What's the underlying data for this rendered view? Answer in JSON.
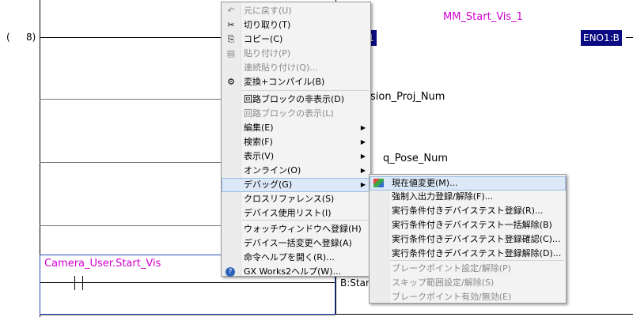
{
  "ladder": {
    "row_label_paren": "(",
    "row_label_num": "8)",
    "fb_title": "MM_Start_Vis_1",
    "fb_left_partial": "1",
    "eno_label": "ENO1:B",
    "param1": "sion_Proj_Num",
    "param2": "q_Pose_Num",
    "contact_label": "Camera_User.Start_Vis",
    "input_partial": "B:Star"
  },
  "context_menu": {
    "items": [
      {
        "label": "元に戻す(U)",
        "icon": "undo-icon",
        "disabled": true
      },
      {
        "label": "切り取り(T)",
        "icon": "scissors-icon",
        "disabled": false
      },
      {
        "label": "コピー(C)",
        "icon": "copy-icon",
        "disabled": false
      },
      {
        "label": "貼り付け(P)",
        "icon": "paste-icon",
        "disabled": true
      },
      {
        "label": "連続貼り付け(Q)...",
        "icon": "",
        "disabled": true
      },
      {
        "label": "変換+コンパイル(B)",
        "icon": "compile-icon",
        "disabled": false
      },
      {
        "label": "回路ブロックの非表示(D)",
        "icon": "",
        "disabled": false
      },
      {
        "label": "回路ブロックの表示(L)",
        "icon": "",
        "disabled": true
      },
      {
        "label": "編集(E)",
        "icon": "",
        "disabled": false,
        "submenu": true
      },
      {
        "label": "検索(F)",
        "icon": "",
        "disabled": false,
        "submenu": true
      },
      {
        "label": "表示(V)",
        "icon": "",
        "disabled": false,
        "submenu": true
      },
      {
        "label": "オンライン(O)",
        "icon": "",
        "disabled": false,
        "submenu": true
      },
      {
        "label": "デバッグ(G)",
        "icon": "",
        "disabled": false,
        "submenu": true,
        "highlighted": true
      },
      {
        "label": "クロスリファレンス(S)",
        "icon": "",
        "disabled": false
      },
      {
        "label": "デバイス使用リスト(I)",
        "icon": "",
        "disabled": false
      },
      {
        "label": "ウォッチウィンドウへ登録(H)",
        "icon": "",
        "disabled": false
      },
      {
        "label": "デバイス一括変更へ登録(A)",
        "icon": "",
        "disabled": false
      },
      {
        "label": "命令ヘルプを開く(R)...",
        "icon": "",
        "disabled": false
      },
      {
        "label": "GX Works2ヘルプ(W)...",
        "icon": "help-icon",
        "disabled": false
      }
    ]
  },
  "debug_submenu": {
    "items": [
      {
        "label": "現在値変更(M)...",
        "icon": "change-value-icon",
        "disabled": false,
        "highlighted": true
      },
      {
        "label": "強制入出力登録/解除(F)...",
        "disabled": false
      },
      {
        "label": "実行条件付きデバイステスト登録(R)...",
        "disabled": false
      },
      {
        "label": "実行条件付きデバイステスト一括解除(B)",
        "disabled": false
      },
      {
        "label": "実行条件付きデバイステスト登録確認(C)...",
        "disabled": false
      },
      {
        "label": "実行条件付きデバイステスト登録解除(D)...",
        "disabled": false
      },
      {
        "label": "ブレークポイント設定/解除(P)",
        "disabled": true
      },
      {
        "label": "スキップ範囲設定/解除(S)",
        "disabled": true
      },
      {
        "label": "ブレークポイント有効/無効(E)",
        "disabled": true
      }
    ]
  }
}
